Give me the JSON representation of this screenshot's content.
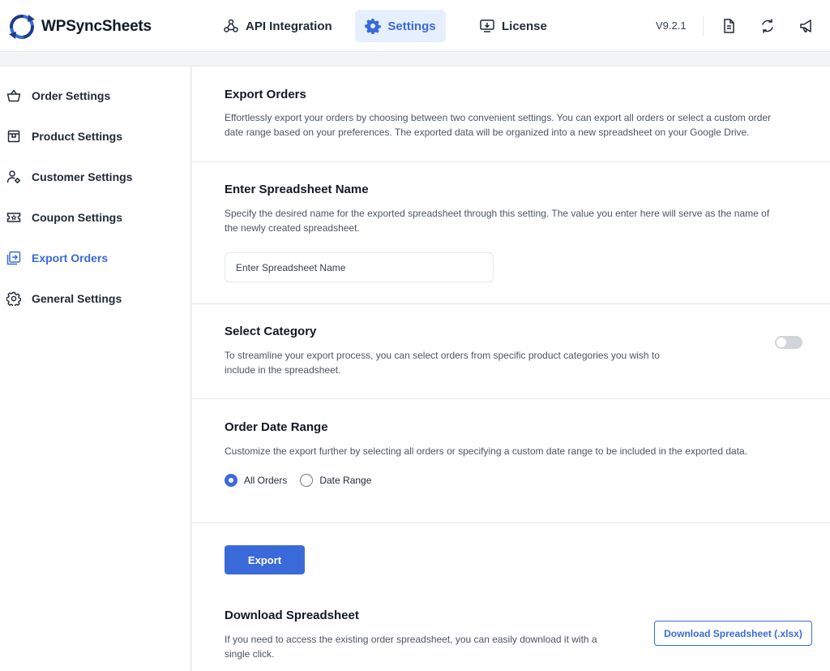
{
  "app": {
    "name": "WPSyncSheets",
    "version": "V9.2.1"
  },
  "nav": {
    "tabs": [
      {
        "label": "API Integration",
        "icon": "api-integration-icon"
      },
      {
        "label": "Settings",
        "icon": "gear-icon",
        "active": true
      },
      {
        "label": "License",
        "icon": "license-icon"
      }
    ]
  },
  "header_icons": [
    "document-icon",
    "sync-icon",
    "megaphone-icon"
  ],
  "sidebar": {
    "items": [
      {
        "label": "Order Settings",
        "icon": "basket-icon"
      },
      {
        "label": "Product Settings",
        "icon": "product-box-icon"
      },
      {
        "label": "Customer Settings",
        "icon": "customer-gear-icon"
      },
      {
        "label": "Coupon Settings",
        "icon": "coupon-icon"
      },
      {
        "label": "Export Orders",
        "icon": "export-icon",
        "active": true
      },
      {
        "label": "General Settings",
        "icon": "gear-icon"
      }
    ]
  },
  "export_orders": {
    "title": "Export Orders",
    "description_line1": "Effortlessly export your orders by choosing between two convenient settings. You can export all orders or select a custom order",
    "description_line2": "date range based on your preferences. The exported data will be organized into a new spreadsheet on your Google Drive."
  },
  "spreadsheet_name": {
    "title": "Enter Spreadsheet Name",
    "description_line1": "Specify the desired name for the exported spreadsheet through this setting. The value you enter here will serve as the name of",
    "description_line2": "the newly created spreadsheet.",
    "placeholder": "Enter Spreadsheet Name",
    "value": ""
  },
  "select_category": {
    "title": "Select Category",
    "description_line1": "To streamline your export process, you can select orders from specific product categories you wish to",
    "description_line2": "include in the spreadsheet.",
    "enabled": false
  },
  "order_date_range": {
    "title": "Order Date Range",
    "description": "Customize the export further by selecting all orders or specifying a custom date range to be included in the exported data.",
    "options": [
      {
        "label": "All Orders",
        "checked": true
      },
      {
        "label": "Date Range",
        "checked": false
      }
    ]
  },
  "export_button": {
    "label": "Export"
  },
  "download": {
    "title": "Download Spreadsheet",
    "description_line1": "If you need to access the existing order spreadsheet, you can easily download it with a",
    "description_line2": "single click.",
    "button_label": "Download Spreadsheet (.xlsx)"
  },
  "colors": {
    "accent": "#3a6ad9",
    "accent_light": "#e6effd",
    "border": "#e5e7eb"
  }
}
